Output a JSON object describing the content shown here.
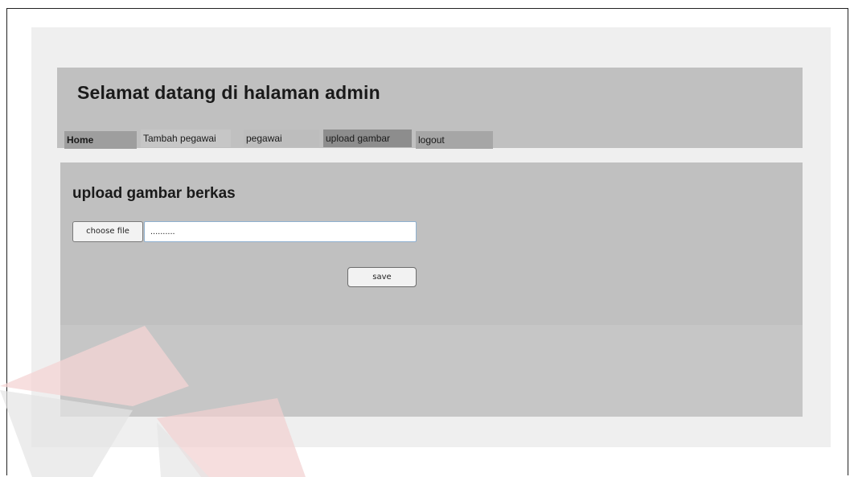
{
  "header": {
    "title": "Selamat datang di halaman admin"
  },
  "nav": {
    "items": [
      {
        "label": "Home"
      },
      {
        "label": "Tambah pegawai"
      },
      {
        "label": "pegawai"
      },
      {
        "label": "upload gambar"
      },
      {
        "label": "logout"
      }
    ],
    "active": "upload gambar"
  },
  "upload": {
    "section_title": "upload gambar berkas",
    "choose_file_label": "choose file",
    "file_value": "..........",
    "save_label": "save"
  },
  "colors": {
    "panel": "#c0c0c0",
    "outer": "#efefef",
    "nav_active": "#8d8d8d"
  }
}
